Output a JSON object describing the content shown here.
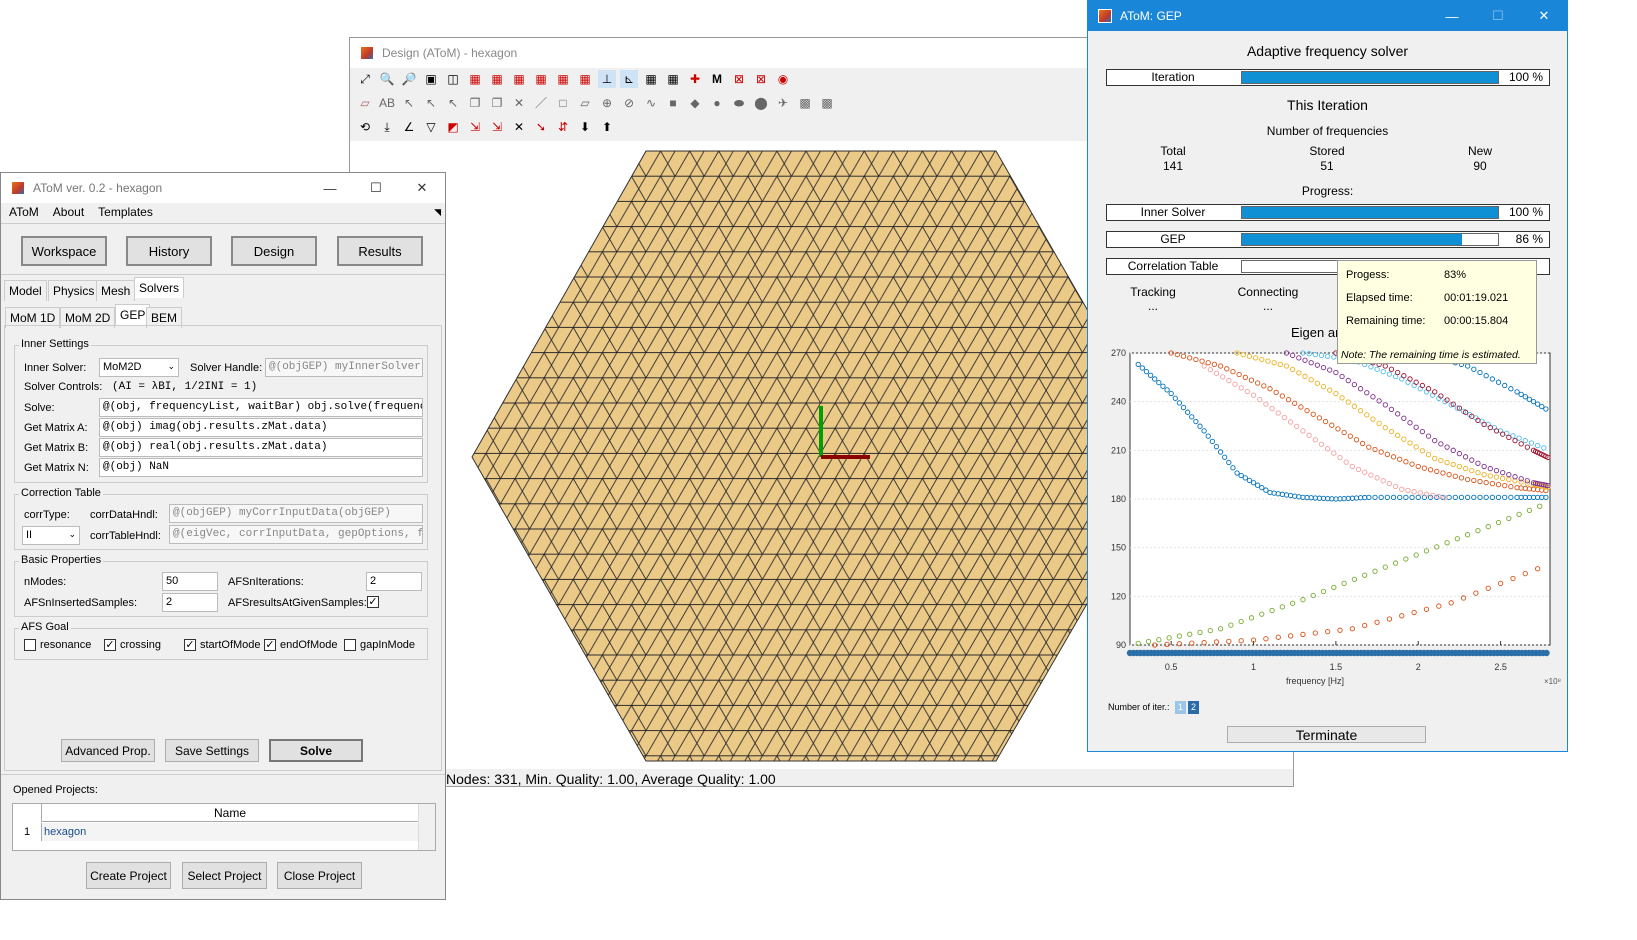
{
  "design": {
    "title": "Design (AToM) - hexagon",
    "status": "Nodes: 331, Min. Quality: 1.00, Average Quality: 1.00"
  },
  "main": {
    "title": "AToM ver. 0.2 - hexagon",
    "menu": [
      "AToM",
      "About",
      "Templates"
    ],
    "buttons": {
      "workspace": "Workspace",
      "history": "History",
      "design": "Design",
      "results": "Results"
    },
    "tabs1": [
      "Model",
      "Physics",
      "Mesh",
      "Solvers"
    ],
    "tabs2": [
      "MoM 1D",
      "MoM 2D",
      "GEP",
      "BEM"
    ],
    "inner": {
      "group": "Inner Settings",
      "inner_solver_lbl": "Inner Solver:",
      "inner_solver_val": "MoM2D",
      "handle_lbl": "Solver Handle:",
      "handle_val": "@(objGEP) myInnerSolver",
      "controls_lbl": "Solver Controls:",
      "controls_val": "(AI = λBI, 1/2INI = 1)",
      "solve_lbl": "Solve:",
      "solve_val": "@(obj, frequencyList, waitBar) obj.solve(frequencyList",
      "matA_lbl": "Get Matrix A:",
      "matA_val": "@(obj) imag(obj.results.zMat.data)",
      "matB_lbl": "Get Matrix B:",
      "matB_val": "@(obj) real(obj.results.zMat.data)",
      "matN_lbl": "Get Matrix N:",
      "matN_val": "@(obj) NaN"
    },
    "corr": {
      "group": "Correction Table",
      "type_lbl": "corrType:",
      "type_val": "II",
      "data_lbl": "corrDataHndl:",
      "data_val": "@(objGEP) myCorrInputData(objGEP)",
      "table_lbl": "corrTableHndl:",
      "table_val": "@(eigVec, corrInputData, gepOptions, fr"
    },
    "basic": {
      "group": "Basic Properties",
      "nmodes_lbl": "nModes:",
      "nmodes_val": "50",
      "afsit_lbl": "AFSnIterations:",
      "afsit_val": "2",
      "afsins_lbl": "AFSnInsertedSamples:",
      "afsins_val": "2",
      "afsres_lbl": "AFSresultsAtGivenSamples:"
    },
    "goal": {
      "group": "AFS Goal",
      "resonance": "resonance",
      "crossing": "crossing",
      "start": "startOfMode",
      "end": "endOfMode",
      "gap": "gapInMode"
    },
    "actions": {
      "adv": "Advanced Prop.",
      "save": "Save Settings",
      "solve": "Solve"
    },
    "projects": {
      "label": "Opened Projects:",
      "col": "Name",
      "row_num": "1",
      "row_name": "hexagon"
    },
    "proj_buttons": {
      "create": "Create Project",
      "select": "Select Project",
      "close": "Close Project"
    }
  },
  "gep": {
    "title": "AToM: GEP",
    "heading": "Adaptive frequency solver",
    "iteration": {
      "label": "Iteration",
      "value": "100 %",
      "pct": 100
    },
    "this_iter": "This Iteration",
    "nfreq": "Number of frequencies",
    "total_lbl": "Total",
    "total": "141",
    "stored_lbl": "Stored",
    "stored": "51",
    "new_lbl": "New",
    "new": "90",
    "progress": "Progress:",
    "inner": {
      "label": "Inner Solver",
      "value": "100 %",
      "pct": 100
    },
    "gep": {
      "label": "GEP",
      "value": "86 %",
      "pct": 86
    },
    "corr": {
      "label": "Correlation Table",
      "pct": 0
    },
    "tracking": "Tracking",
    "tracking_v": "...",
    "connecting": "Connecting",
    "connecting_v": "...",
    "eigen_partial": "Eigen an",
    "tooltip": {
      "prog_lbl": "Progess:",
      "prog": "83%",
      "el_lbl": "Elapsed time:",
      "el": "00:01:19.021",
      "rem_lbl": "Remaining time:",
      "rem": "00:00:15.804",
      "note": "Note: The remaining time is estimated."
    },
    "iter_lbl": "Number of iter.:",
    "iter1": "1",
    "iter2": "2",
    "terminate": "Terminate"
  },
  "chart_data": {
    "type": "scatter",
    "xlabel": "frequency [Hz]",
    "x_exponent": "×10⁸",
    "ylabel": "",
    "xlim": [
      0.25,
      2.8
    ],
    "ylim": [
      90,
      270
    ],
    "xticks": [
      "0.5",
      "1",
      "1.5",
      "2",
      "2.5"
    ],
    "yticks": [
      "90",
      "120",
      "150",
      "180",
      "210",
      "240",
      "270"
    ],
    "series": [
      {
        "color": "#0072bd",
        "x": [
          0.3,
          0.5,
          0.7,
          0.9,
          1.1,
          1.3,
          1.5,
          1.7,
          2.0,
          2.3,
          2.6,
          2.8
        ],
        "y": [
          263,
          245,
          222,
          196,
          184,
          181,
          180,
          181,
          181,
          181,
          181,
          181
        ]
      },
      {
        "color": "#d95319",
        "x": [
          0.5,
          0.8,
          1.1,
          1.4,
          1.7,
          2.0,
          2.3,
          2.6,
          2.8
        ],
        "y": [
          270,
          262,
          248,
          230,
          212,
          200,
          192,
          187,
          185
        ]
      },
      {
        "color": "#edb120",
        "x": [
          0.9,
          1.2,
          1.5,
          1.8,
          2.1,
          2.4,
          2.7,
          2.8
        ],
        "y": [
          270,
          262,
          245,
          224,
          205,
          195,
          189,
          187
        ]
      },
      {
        "color": "#7e2f8e",
        "x": [
          1.2,
          1.5,
          1.8,
          2.1,
          2.4,
          2.7,
          2.8
        ],
        "y": [
          270,
          258,
          238,
          216,
          200,
          190,
          188
        ]
      },
      {
        "color": "#77ac30",
        "x": [
          0.3,
          0.8,
          1.3,
          1.8,
          2.3,
          2.8
        ],
        "y": [
          91,
          100,
          118,
          138,
          158,
          178
        ]
      },
      {
        "color": "#4dbeee",
        "x": [
          1.3,
          1.6,
          1.9,
          2.2,
          2.5,
          2.8
        ],
        "y": [
          270,
          266,
          254,
          238,
          222,
          210
        ]
      },
      {
        "color": "#a2142f",
        "x": [
          1.5,
          1.8,
          2.1,
          2.4,
          2.7,
          2.8
        ],
        "y": [
          270,
          262,
          246,
          226,
          210,
          205
        ]
      },
      {
        "color": "#d95319",
        "x": [
          0.4,
          1.0,
          1.6,
          2.2,
          2.8
        ],
        "y": [
          90,
          93,
          100,
          116,
          140
        ]
      },
      {
        "color": "#0072bd",
        "x": [
          2.0,
          2.3,
          2.6,
          2.8
        ],
        "y": [
          270,
          262,
          246,
          234
        ]
      },
      {
        "color": "#f4a0a0",
        "x": [
          0.7,
          1.0,
          1.3,
          1.6,
          1.9,
          2.2
        ],
        "y": [
          262,
          244,
          222,
          200,
          186,
          180
        ]
      }
    ]
  }
}
